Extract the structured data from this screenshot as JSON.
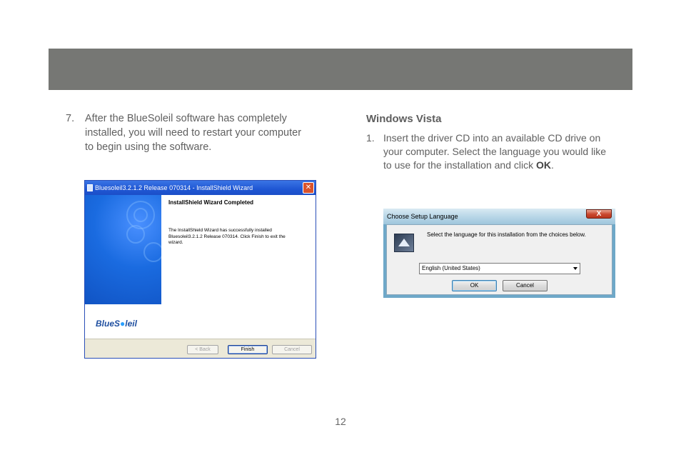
{
  "step7": {
    "number": "7.",
    "text": "After the BlueSoleil software has completely installed, you will need to restart your computer to begin using the software."
  },
  "section": {
    "title": "Windows Vista"
  },
  "step1": {
    "number": "1.",
    "text": "Insert the driver CD into an available CD drive on your computer. Select the language you would like to use for the installation and click ",
    "bold": "OK",
    "end": "."
  },
  "xp_window": {
    "title": "Bluesoleil3.2.1.2 Release 070314 - InstallShield Wizard",
    "close_label": "✕",
    "heading": "InstallShield Wizard Completed",
    "message": "The InstallShield Wizard has successfully installed Bluesoleil3.2.1.2 Release 070314. Click Finish to exit the wizard.",
    "logo_prefix": "BlueS",
    "logo_dot": "●",
    "logo_suffix": "leil",
    "back_label": "< Back",
    "finish_label": "Finish",
    "cancel_label": "Cancel"
  },
  "vista_dialog": {
    "title": "Choose Setup Language",
    "close_label": "X",
    "message": "Select the language for this installation from the choices below.",
    "language_value": "English (United States)",
    "ok_label": "OK",
    "cancel_label": "Cancel"
  },
  "page": {
    "number": "12"
  },
  "colors": {
    "header_band": "#767774",
    "xp_titlebar": "#1f56d3",
    "vista_close": "#c9462c"
  }
}
